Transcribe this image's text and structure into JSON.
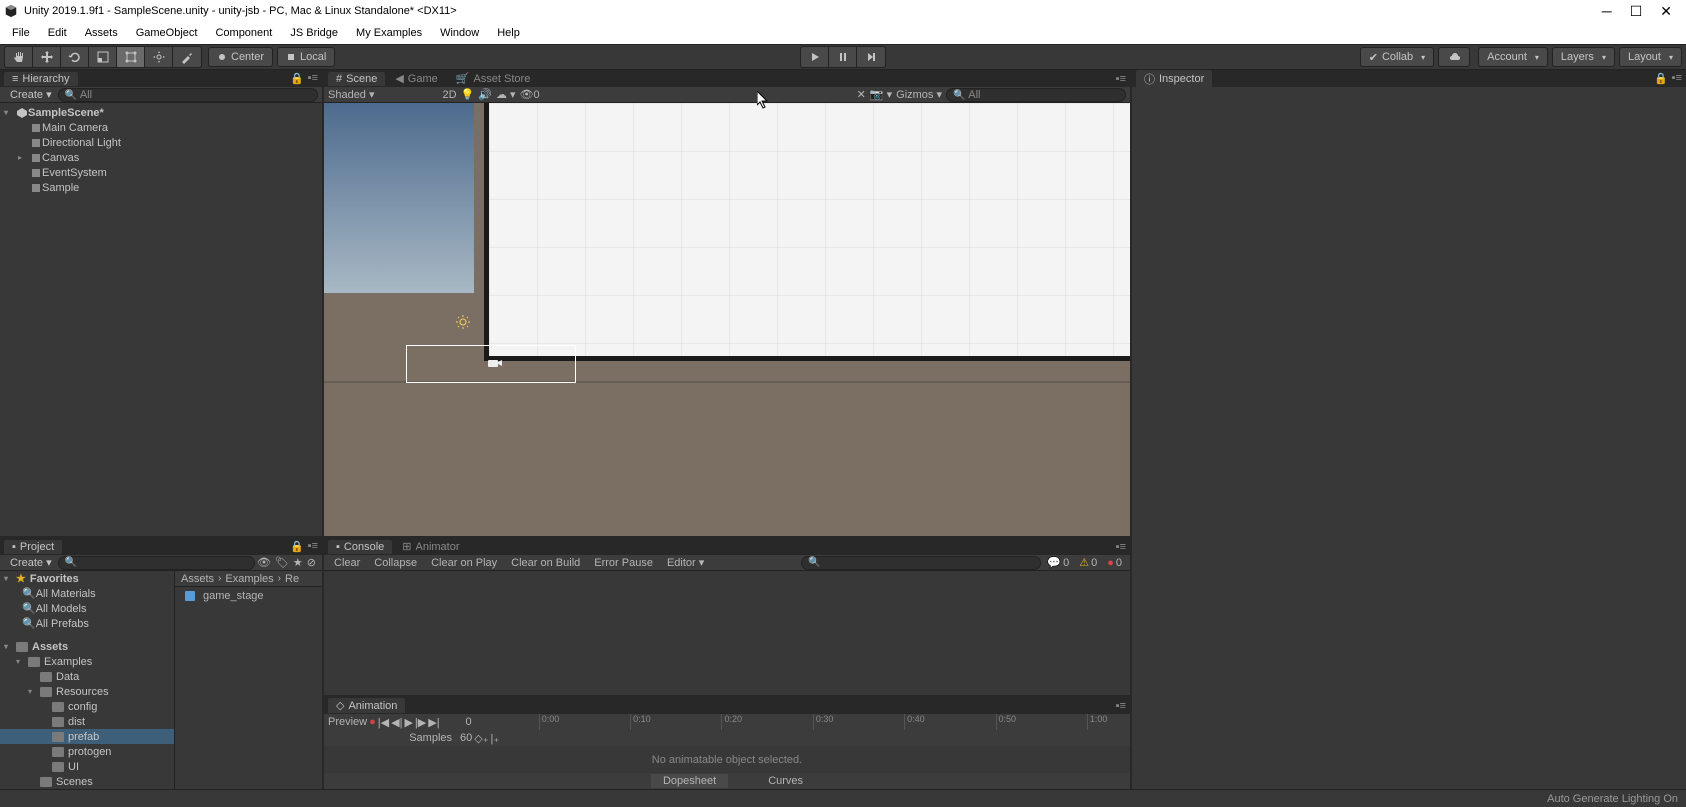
{
  "window": {
    "title": "Unity 2019.1.9f1 - SampleScene.unity - unity-jsb - PC, Mac & Linux Standalone* <DX11>"
  },
  "menubar": [
    "File",
    "Edit",
    "Assets",
    "GameObject",
    "Component",
    "JS Bridge",
    "My Examples",
    "Window",
    "Help"
  ],
  "toolbar": {
    "pivot": "Center",
    "handle": "Local",
    "collab": "Collab",
    "account": "Account",
    "layers": "Layers",
    "layout": "Layout"
  },
  "hierarchy": {
    "tab": "Hierarchy",
    "create": "Create",
    "search_placeholder": "All",
    "scene": "SampleScene*",
    "items": [
      "Main Camera",
      "Directional Light",
      "Canvas",
      "EventSystem",
      "Sample"
    ]
  },
  "scene": {
    "tabs": {
      "scene": "Scene",
      "game": "Game",
      "asset_store": "Asset Store"
    },
    "shading": "Shaded",
    "mode_2d": "2D",
    "audio_count": "0",
    "gizmos": "Gizmos",
    "search_placeholder": "All"
  },
  "console": {
    "tabs": {
      "console": "Console",
      "animator": "Animator"
    },
    "buttons": {
      "clear": "Clear",
      "collapse": "Collapse",
      "clear_on_play": "Clear on Play",
      "clear_on_build": "Clear on Build",
      "error_pause": "Error Pause",
      "editor": "Editor"
    },
    "counts": {
      "info": "0",
      "warn": "0",
      "error": "0"
    }
  },
  "animation": {
    "tab": "Animation",
    "preview": "Preview",
    "frame": "0",
    "samples_label": "Samples",
    "samples": "60",
    "ticks": [
      "0:00",
      "0:10",
      "0:20",
      "0:30",
      "0:40",
      "0:50",
      "1:00"
    ],
    "empty": "No animatable object selected.",
    "dopesheet": "Dopesheet",
    "curves": "Curves"
  },
  "project": {
    "tab": "Project",
    "create": "Create",
    "favorites": "Favorites",
    "fav_items": [
      "All Materials",
      "All Models",
      "All Prefabs"
    ],
    "assets": "Assets",
    "tree": [
      "Examples",
      "Data",
      "Resources",
      "config",
      "dist",
      "prefab",
      "protogen",
      "UI",
      "Scenes"
    ],
    "breadcrumb": [
      "Assets",
      "Examples",
      "Re"
    ],
    "content_item": "game_stage"
  },
  "inspector": {
    "tab": "Inspector"
  },
  "status": {
    "text": "Auto Generate Lighting On"
  }
}
